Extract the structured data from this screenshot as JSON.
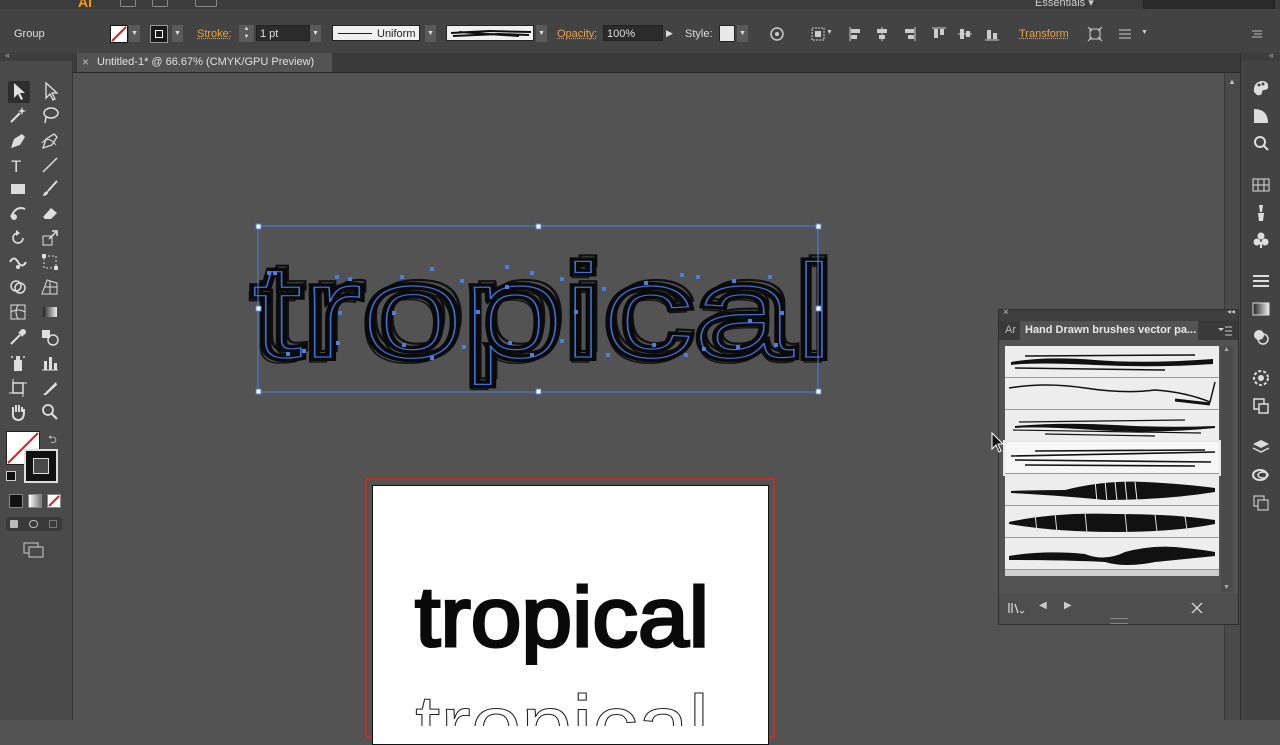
{
  "app": {
    "logo": "Ai",
    "workspace": "Essentials"
  },
  "control_bar": {
    "selection_type": "Group",
    "stroke_label": "Stroke:",
    "stroke_weight": "1 pt",
    "profile_label": "Uniform",
    "opacity_label": "Opacity:",
    "opacity_value": "100%",
    "style_label": "Style:",
    "transform_label": "Transform"
  },
  "document_tab": {
    "title": "Untitled-1* @ 66.67% (CMYK/GPU Preview)",
    "close": "×"
  },
  "artwork": {
    "text": "tropical"
  },
  "artboard": {
    "text_brushed": "tropical",
    "text_plain": "tropical"
  },
  "brushes_panel": {
    "title": "Hand Drawn brushes vector pa...",
    "tab_short": "Ar",
    "brush_count": 7,
    "selected_index": 3
  },
  "colors": {
    "accent": "#e8a34a",
    "selection": "#4a7fe0",
    "artboard_border": "#c0302a",
    "panel": "#535353"
  }
}
